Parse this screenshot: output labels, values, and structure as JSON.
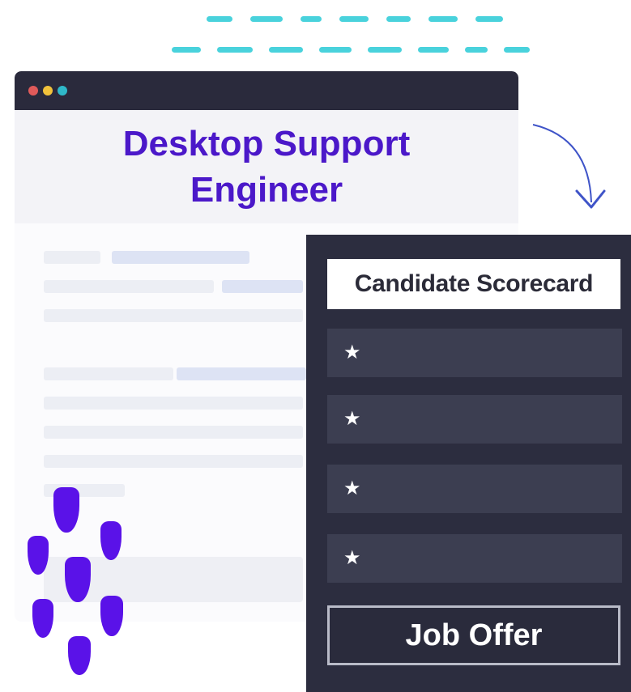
{
  "job": {
    "title": "Desktop Support Engineer"
  },
  "scorecard": {
    "heading": "Candidate Scorecard",
    "items": [
      {
        "icon": "star-icon"
      },
      {
        "icon": "star-icon"
      },
      {
        "icon": "star-icon"
      },
      {
        "icon": "star-icon"
      }
    ],
    "star_glyph": "★",
    "action_label": "Job Offer"
  },
  "colors": {
    "accent": "#4b18c9",
    "panel": "#2c2d3f",
    "dashes": "#3fd0da",
    "shields": "#5a12e8",
    "window_dots": [
      "#e05a5a",
      "#f1c23b",
      "#2fb8c9"
    ]
  }
}
